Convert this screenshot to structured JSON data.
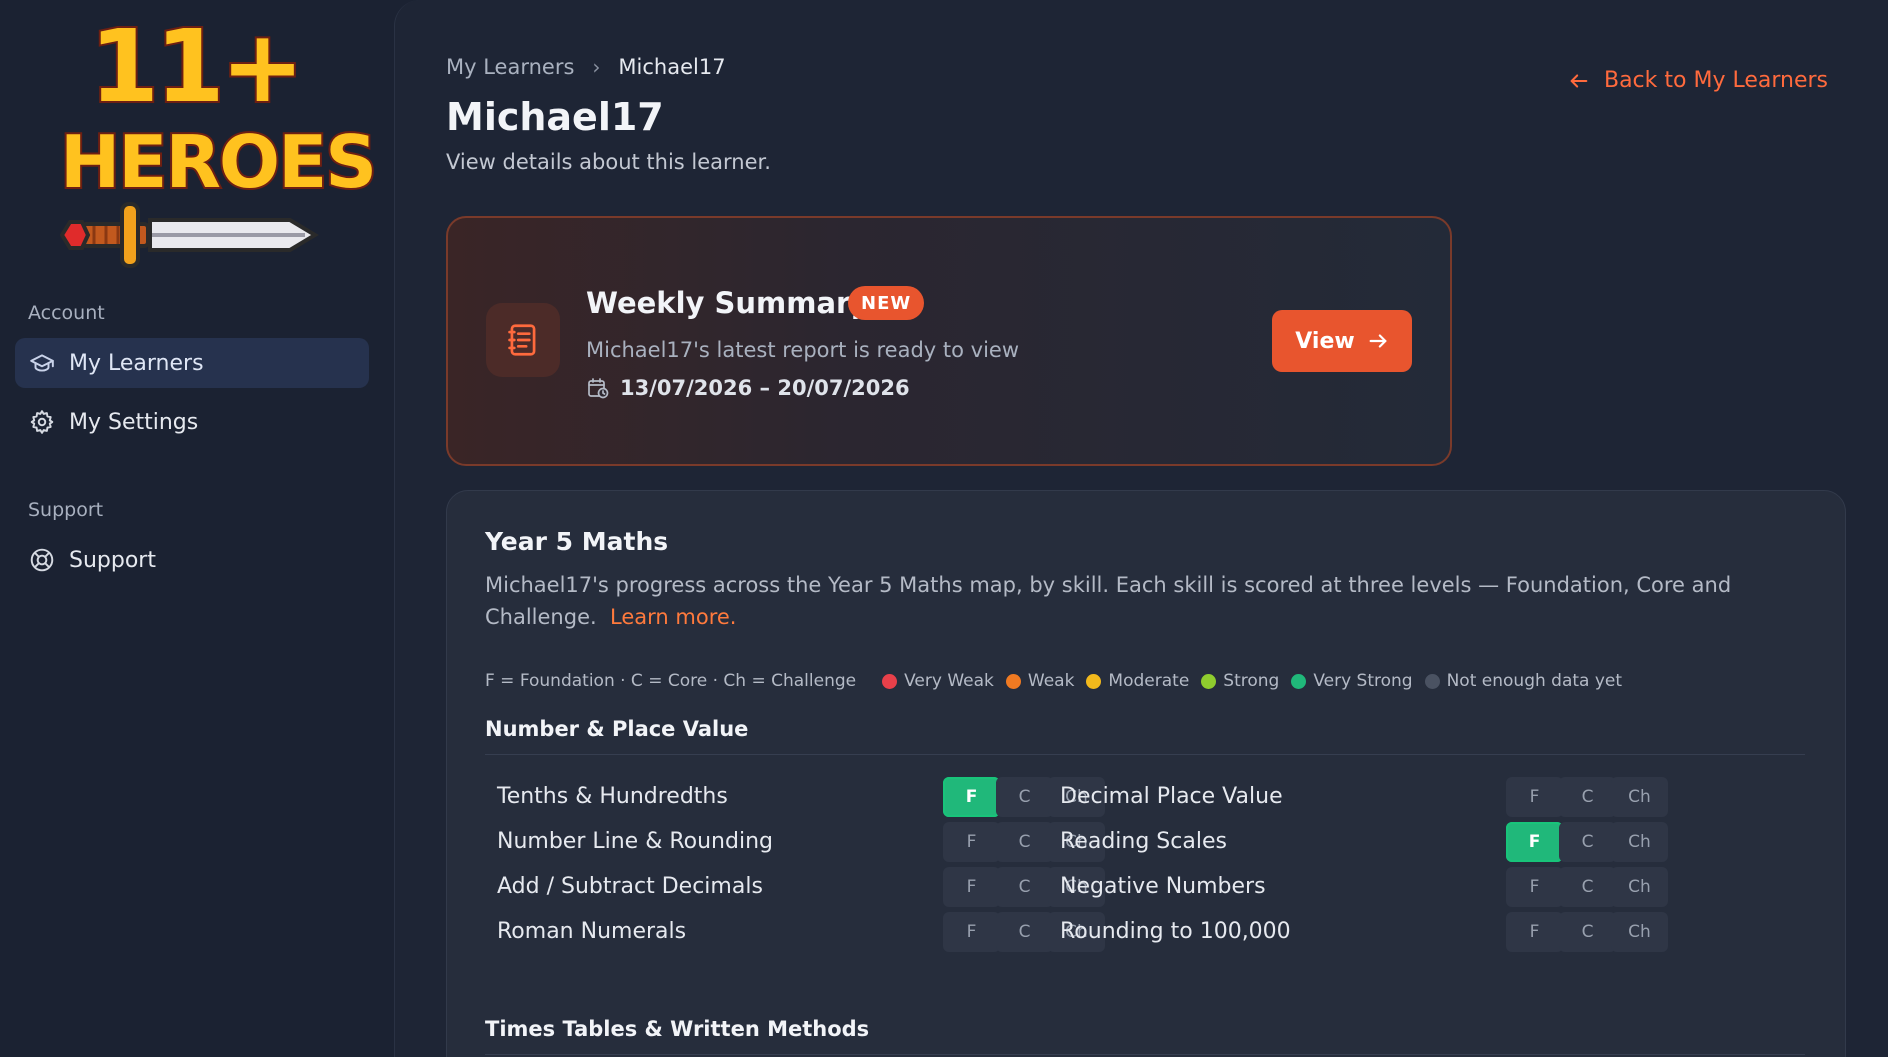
{
  "logo": {
    "line1": "11+",
    "line2": "HEROES"
  },
  "sidebar": {
    "sections": [
      {
        "label": "Account",
        "items": [
          {
            "label": "My Learners",
            "icon": "graduation-cap-icon",
            "active": true
          },
          {
            "label": "My Settings",
            "icon": "gear-icon",
            "active": false
          }
        ]
      },
      {
        "label": "Support",
        "items": [
          {
            "label": "Support",
            "icon": "lifebuoy-icon",
            "active": false
          }
        ]
      }
    ]
  },
  "breadcrumb": {
    "parent": "My Learners",
    "current": "Michael17"
  },
  "back_link": "Back to My Learners",
  "page": {
    "title": "Michael17",
    "subtitle": "View details about this learner."
  },
  "summary": {
    "title": "Weekly Summary",
    "badge": "NEW",
    "text": "Michael17's latest report is ready to view",
    "dates": "13/07/2026 – 20/07/2026",
    "button": "View"
  },
  "maths": {
    "title": "Year 5 Maths",
    "description": "Michael17's progress across the Year 5 Maths map, by skill. Each skill is scored at three levels — Foundation, Core and Challenge.",
    "learn_more": "Learn more.",
    "legend_key": "F = Foundation · C = Core · Ch = Challenge",
    "legend": [
      {
        "label": "Very Weak",
        "color": "#e8404a"
      },
      {
        "label": "Weak",
        "color": "#f07a22"
      },
      {
        "label": "Moderate",
        "color": "#f2b91c"
      },
      {
        "label": "Strong",
        "color": "#8fcc2e"
      },
      {
        "label": "Very Strong",
        "color": "#20b87a"
      },
      {
        "label": "Not enough data yet",
        "color": "#4a5262"
      }
    ],
    "levels": [
      "F",
      "C",
      "Ch"
    ],
    "sections": [
      {
        "title": "Number & Place Value",
        "skills": [
          {
            "name": "Tenths & Hundredths",
            "F": "Very Strong",
            "C": "Not enough data yet",
            "Ch": "Not enough data yet"
          },
          {
            "name": "Decimal Place Value",
            "F": "Not enough data yet",
            "C": "Not enough data yet",
            "Ch": "Not enough data yet"
          },
          {
            "name": "Number Line & Rounding",
            "F": "Not enough data yet",
            "C": "Not enough data yet",
            "Ch": "Not enough data yet"
          },
          {
            "name": "Reading Scales",
            "F": "Very Strong",
            "C": "Not enough data yet",
            "Ch": "Not enough data yet"
          },
          {
            "name": "Add / Subtract Decimals",
            "F": "Not enough data yet",
            "C": "Not enough data yet",
            "Ch": "Not enough data yet"
          },
          {
            "name": "Negative Numbers",
            "F": "Not enough data yet",
            "C": "Not enough data yet",
            "Ch": "Not enough data yet"
          },
          {
            "name": "Roman Numerals",
            "F": "Not enough data yet",
            "C": "Not enough data yet",
            "Ch": "Not enough data yet"
          },
          {
            "name": "Rounding to 100,000",
            "F": "Not enough data yet",
            "C": "Not enough data yet",
            "Ch": "Not enough data yet"
          }
        ]
      },
      {
        "title": "Times Tables & Written Methods",
        "skills": []
      }
    ]
  }
}
